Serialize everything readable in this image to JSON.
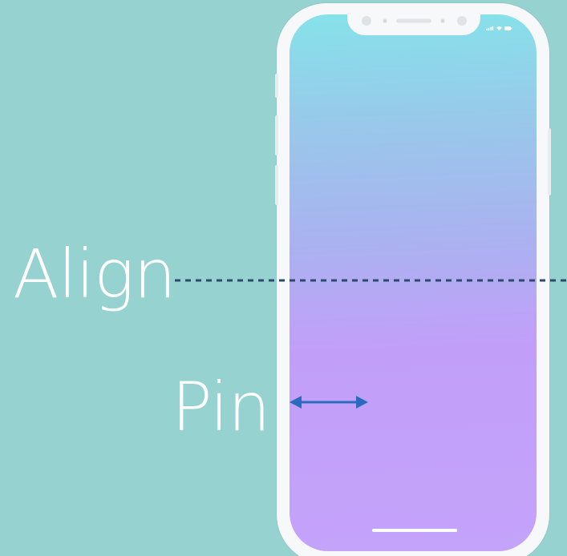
{
  "labels": {
    "align": "Align",
    "pin": "Pin"
  },
  "colors": {
    "background": "#95d2d0",
    "guide_line": "#2c4a6b",
    "pin_arrow": "#2a6bc0",
    "phone_frame": "#f6f8f9",
    "screen_top": "#86e2ea",
    "screen_bottom": "#c4a3fb",
    "label_text": "#ffffff"
  },
  "icons": {
    "status": [
      "signal-icon",
      "wifi-icon",
      "battery-icon"
    ]
  }
}
